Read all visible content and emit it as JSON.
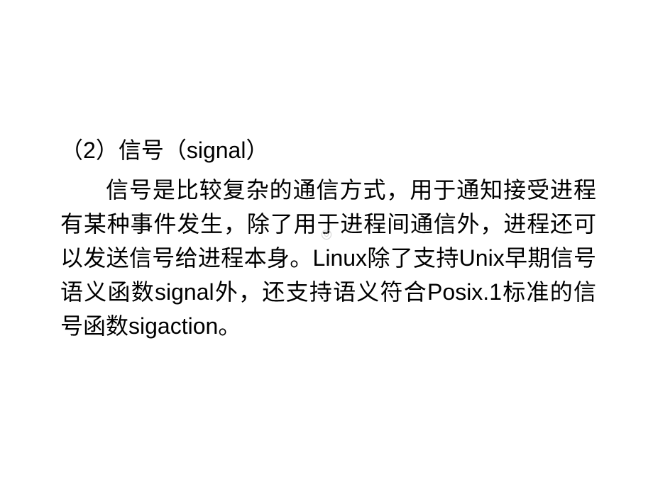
{
  "slide": {
    "heading_prefix": "（",
    "heading_number": "2",
    "heading_suffix": "）信号（",
    "heading_term": "signal",
    "heading_close": "）",
    "body_part1": "信号是比较复杂的通信方式，用于通知接受进程有某种事件发生，除了用于进程间通信外，进程还可以发送信号给进程本身。",
    "body_linux": "Linux",
    "body_part2": "除了支持",
    "body_unix": "Unix",
    "body_part3": "早期信号语义函数",
    "body_signal": "signal",
    "body_part4": "外，还支持语义符合",
    "body_posix": "Posix.1",
    "body_part5": "标准的信号函数",
    "body_sigaction": "sigaction",
    "body_end": "。"
  }
}
